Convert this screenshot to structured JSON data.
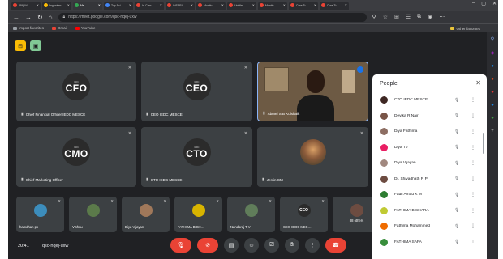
{
  "browser": {
    "tabs": [
      {
        "label": "(89) W…",
        "color": "#ea4335"
      },
      {
        "label": "Ingenium",
        "color": "#fbbc04"
      },
      {
        "label": "Me",
        "color": "#34a853",
        "active": true
      },
      {
        "label": "Top Sci…",
        "color": "#4285f4"
      },
      {
        "label": "In-Cam…",
        "color": "#ea4335"
      },
      {
        "label": "INSPRI…",
        "color": "#ea4335"
      },
      {
        "label": "Monito…",
        "color": "#ea4335"
      },
      {
        "label": "Untitle…",
        "color": "#ea4335"
      },
      {
        "label": "Monito…",
        "color": "#ea4335"
      },
      {
        "label": "Core Tr…",
        "color": "#ea4335"
      },
      {
        "label": "Core Tr…",
        "color": "#ea4335"
      }
    ],
    "url": "https://meet.google.com/qsc-hqej-uxw",
    "bookmarks": [
      {
        "label": "Import favorites",
        "color": "#9aa0a6"
      },
      {
        "label": "Gmail",
        "color": "#ea4335"
      },
      {
        "label": "YouTube",
        "color": "#ff0000"
      }
    ],
    "other_favorites": "Other favorites"
  },
  "meet": {
    "tiles": [
      {
        "id": "cfo",
        "logo": "CFO",
        "name": "Chief Financial Officer IEDC MESCE"
      },
      {
        "id": "ceo",
        "logo": "CEO",
        "name": "CEO IEDC MESCE"
      },
      {
        "id": "abmel",
        "name": "Abmel S B Kulshaik"
      },
      {
        "id": "cmo",
        "logo": "CMO",
        "name": "Chief Marketing Officer"
      },
      {
        "id": "cto",
        "logo": "CTO",
        "name": "CTO IEDC MESCE"
      },
      {
        "id": "jestin",
        "name": "Jestin CM"
      }
    ],
    "logo_sub": "IEDC",
    "small_tiles": [
      {
        "name": "hamdhan pk",
        "color": "#3c8dbc"
      },
      {
        "name": "Vishnu",
        "color": "#5b7a4a"
      },
      {
        "name": "Diya Vijayan",
        "color": "#a0785a"
      },
      {
        "name": "FATHIMA BISH…",
        "color": "#d8b400"
      },
      {
        "name": "Nandaraj T V",
        "color": "#607d5a"
      },
      {
        "name": "CEO IEDC MES…",
        "color": "#2b2b2b",
        "logo": "CEO"
      },
      {
        "name": "88 others",
        "color": "#6d4c41"
      }
    ],
    "time": "20:41",
    "code": "qsc-hqej-uxw",
    "participant_count": "100"
  },
  "people": {
    "title": "People",
    "list": [
      {
        "name": "CTO IEDC MESCE",
        "color": "#3e2723"
      },
      {
        "name": "Devika R Nair",
        "color": "#795548"
      },
      {
        "name": "Diya Fathima",
        "color": "#8d6e63"
      },
      {
        "name": "Diya Tp",
        "color": "#e91e63"
      },
      {
        "name": "Diya Vijayan",
        "color": "#a1887f"
      },
      {
        "name": "Dr. Shivadhath R P",
        "color": "#6d4c41"
      },
      {
        "name": "Fadil Amad K M",
        "color": "#2e7d32"
      },
      {
        "name": "FATHIMA BISHARA",
        "color": "#c0ca33"
      },
      {
        "name": "Fathima Mohammed",
        "color": "#ef6c00"
      },
      {
        "name": "FATHIMA SAFA",
        "color": "#388e3c"
      }
    ]
  }
}
